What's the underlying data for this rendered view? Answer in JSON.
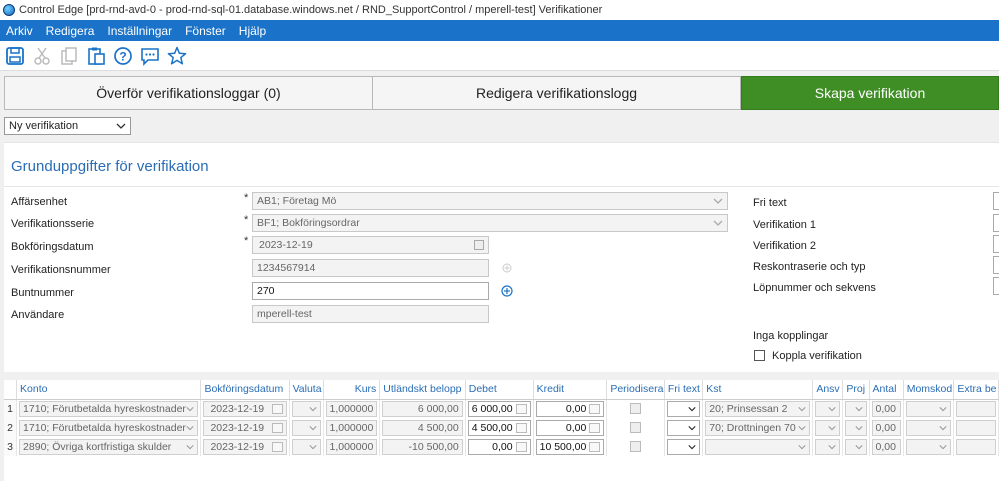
{
  "window": {
    "title": "Control Edge [prd-rnd-avd-0 - prod-rnd-sql-01.database.windows.net / RND_SupportControl / mperell-test] Verifikationer"
  },
  "menu": {
    "items": [
      "Arkiv",
      "Redigera",
      "Inställningar",
      "Fönster",
      "Hjälp"
    ]
  },
  "toolbar": {
    "icons": [
      "save-icon",
      "cut-icon",
      "copy-icon",
      "paste-icon",
      "help-icon",
      "chat-icon",
      "star-icon"
    ]
  },
  "tabs": [
    {
      "label": "Överför verifikationsloggar (0)"
    },
    {
      "label": "Redigera verifikationslogg"
    },
    {
      "label": "Skapa verifikation"
    }
  ],
  "type_select": {
    "value": "Ny verifikation"
  },
  "form": {
    "title": "Grunduppgifter för verifikation",
    "required_mark": "*",
    "affarsenhet": {
      "label": "Affärsenhet",
      "value": "AB1; Företag Mö"
    },
    "verifikationsserie": {
      "label": "Verifikationsserie",
      "value": "BF1; Bokföringsordrar"
    },
    "bokforingsdatum": {
      "label": "Bokföringsdatum",
      "value": "2023-12-19"
    },
    "verifikationsnummer": {
      "label": "Verifikationsnummer",
      "value": "1234567914"
    },
    "buntnummer": {
      "label": "Buntnummer",
      "value": "270"
    },
    "anvandare": {
      "label": "Användare",
      "value": "mperell-test"
    },
    "right": {
      "fri_text": "Fri text",
      "verifikation1": "Verifikation 1",
      "verifikation2": "Verifikation 2",
      "reskontra": "Reskontraserie och typ",
      "lopnummer": "Löpnummer och sekvens",
      "inga_kopplingar": "Inga kopplingar",
      "koppla": "Koppla verifikation"
    }
  },
  "grid": {
    "columns": [
      "Konto",
      "Bokföringsdatum",
      "Valuta",
      "Kurs",
      "Utländskt belopp",
      "Debet",
      "Kredit",
      "Periodisera",
      "Fri text",
      "Kst",
      "Ansv",
      "Proj",
      "Antal",
      "Momskod",
      "Extra be"
    ],
    "rows": [
      {
        "num": "1",
        "konto": "1710; Förutbetalda hyreskostnader",
        "datum": "2023-12-19",
        "kurs": "1,000000",
        "utl": "6 000,00",
        "debet": "6 000,00",
        "kredit": "0,00",
        "kst": "20; Prinsessan 2",
        "antal": "0,00"
      },
      {
        "num": "2",
        "konto": "1710; Förutbetalda hyreskostnader",
        "datum": "2023-12-19",
        "kurs": "1,000000",
        "utl": "4 500,00",
        "debet": "4 500,00",
        "kredit": "0,00",
        "kst": "70; Drottningen 70",
        "antal": "0,00"
      },
      {
        "num": "3",
        "konto": "2890; Övriga kortfristiga skulder",
        "datum": "2023-12-19",
        "kurs": "1,000000",
        "utl": "-10 500,00",
        "debet": "0,00",
        "kredit": "10 500,00",
        "kst": "",
        "antal": "0,00"
      }
    ]
  }
}
